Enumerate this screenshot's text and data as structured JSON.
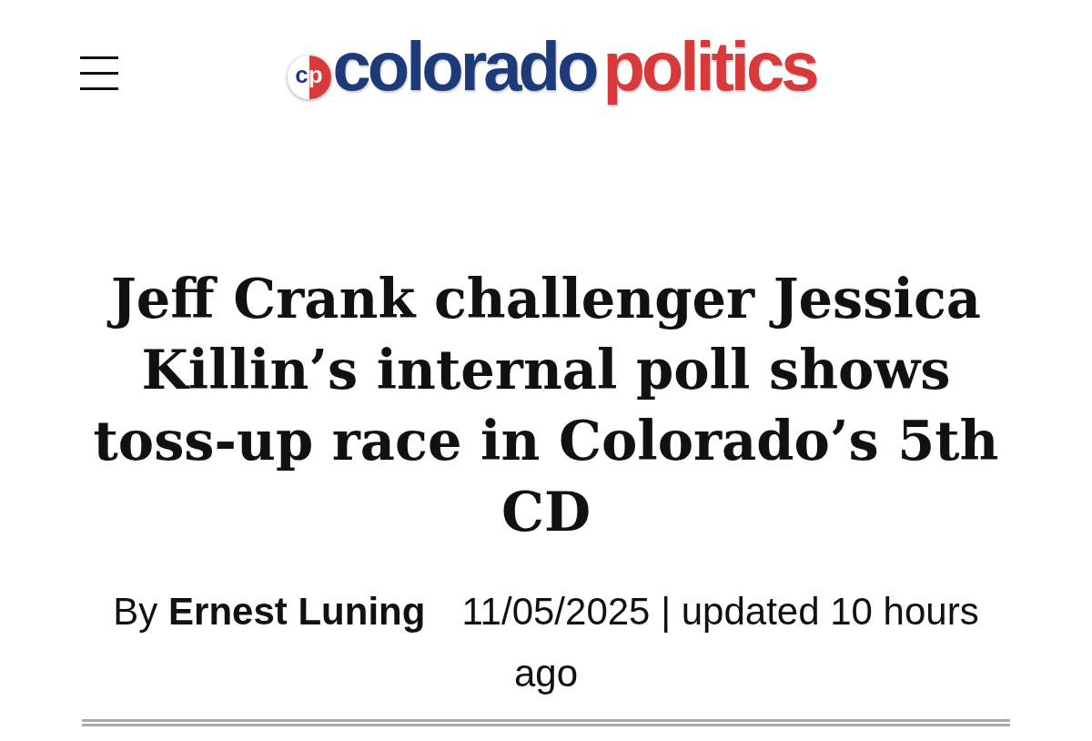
{
  "header": {
    "logo": {
      "badge": "cp",
      "words": [
        "colorado",
        "politics"
      ]
    }
  },
  "article": {
    "headline": "Jeff Crank challenger Jessica Killin’s internal poll shows toss-up race in Colorado’s 5th CD",
    "byline": {
      "prefix": "By",
      "author": "Ernest Luning",
      "date": "11/05/2025 | updated 10 hours ago"
    }
  }
}
